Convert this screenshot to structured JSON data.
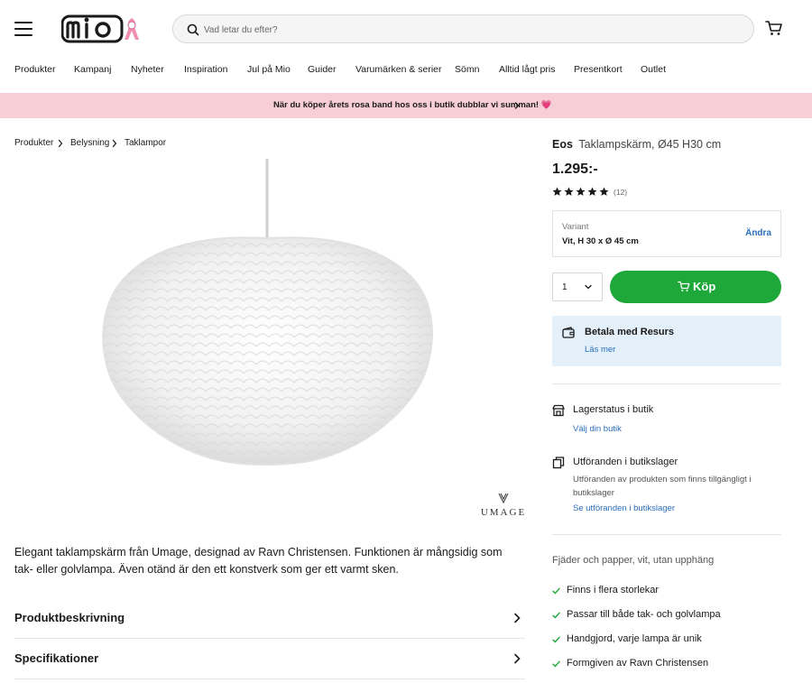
{
  "header": {
    "logo_text": "mio",
    "search_placeholder": "Vad letar du efter?"
  },
  "nav": {
    "items": [
      "Produkter",
      "Kampanj",
      "Nyheter",
      "Inspiration",
      "Jul på Mio",
      "Guider",
      "Varumärken & serier",
      "Sömn",
      "Alltid lågt pris",
      "Presentkort",
      "Outlet"
    ]
  },
  "promo": {
    "text": "När du köper årets rosa band hos oss i butik dubblar vi summan! 💗"
  },
  "breadcrumb": [
    "Produkter",
    "Belysning",
    "Taklampor"
  ],
  "product": {
    "brand_logo_text": "UMAGE",
    "brand": "Eos",
    "name": "Taklampskärm, Ø45 H30 cm",
    "price": "1.295:-",
    "rating_value": 5,
    "rating_count": "(12)",
    "description": "Elegant taklampskärm från Umage, designad av Ravn Christensen. Funktionen är mångsidig som tak- eller golvlampa. Även otänd är den ett konstverk som ger ett varmt sken."
  },
  "variant": {
    "label": "Variant",
    "value": "Vit, H 30 x Ø 45 cm",
    "change_label": "Ändra"
  },
  "purchase": {
    "quantity": "1",
    "buy_label": "Köp"
  },
  "resurs": {
    "title": "Betala med Resurs",
    "link": "Läs mer"
  },
  "stock": {
    "title": "Lagerstatus i butik",
    "link": "Välj din butik"
  },
  "display": {
    "title": "Utföranden i butikslager",
    "text": "Utföranden av produkten som finns tillgängligt i butikslager",
    "link": "Se utföranden i butikslager"
  },
  "accordions": [
    "Produktbeskrivning",
    "Specifikationer"
  ],
  "material": "Fjäder och papper, vit, utan upphäng",
  "features": [
    "Finns i flera storlekar",
    "Passar till både tak- och golvlampa",
    "Handgjord, varje lampa är unik",
    "Formgiven av Ravn Christensen"
  ],
  "colors": {
    "buy_green": "#1ea83a",
    "promo_pink": "#f7cdd6",
    "link_blue": "#2a6ebb",
    "resurs_bg": "#e3f0fa"
  }
}
